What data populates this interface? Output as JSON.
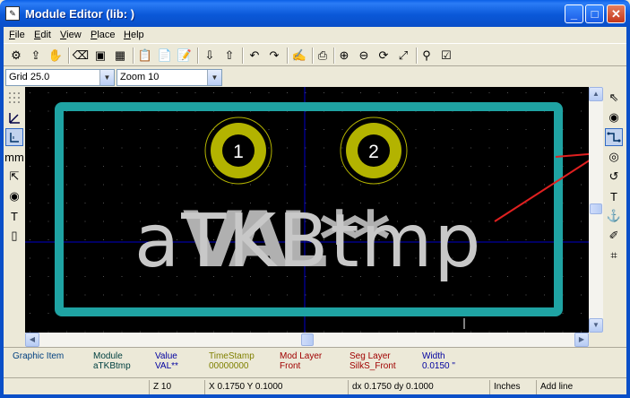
{
  "window": {
    "title": "Module Editor (lib: )"
  },
  "menu": [
    {
      "label_u": "F",
      "label_rest": "ile"
    },
    {
      "label_u": "E",
      "label_rest": "dit"
    },
    {
      "label_u": "V",
      "label_rest": "iew"
    },
    {
      "label_u": "P",
      "label_rest": "lace"
    },
    {
      "label_u": "H",
      "label_rest": "elp"
    }
  ],
  "selects": {
    "grid": "Grid 25.0",
    "zoom": "Zoom 10"
  },
  "canvas": {
    "pad1": "1",
    "pad2": "2",
    "text_main": "aTKBtmp",
    "text_overlay": "VAL**",
    "colors": {
      "outline": "#1fa3a3",
      "pad": "#b3b300",
      "grid_axis": "#0000c8",
      "text": "#c8c8c8"
    }
  },
  "info": {
    "graphic_item": "Graphic Item",
    "module_label": "Module",
    "module_value": "aTKBtmp",
    "value_label": "Value",
    "value_value": "VAL**",
    "timestamp_label": "TimeStamp",
    "timestamp_value": "00000000",
    "modlayer_label": "Mod Layer",
    "modlayer_value": "Front",
    "seglayer_label": "Seg Layer",
    "seglayer_value": "SilkS_Front",
    "width_label": "Width",
    "width_value": "0.0150 \""
  },
  "status": {
    "zoom": "Z 10",
    "xy": "X 0.1750  Y 0.1000",
    "dxdy": "dx 0.1750  dy 0.1000",
    "units": "Inches",
    "mode": "Add line"
  }
}
